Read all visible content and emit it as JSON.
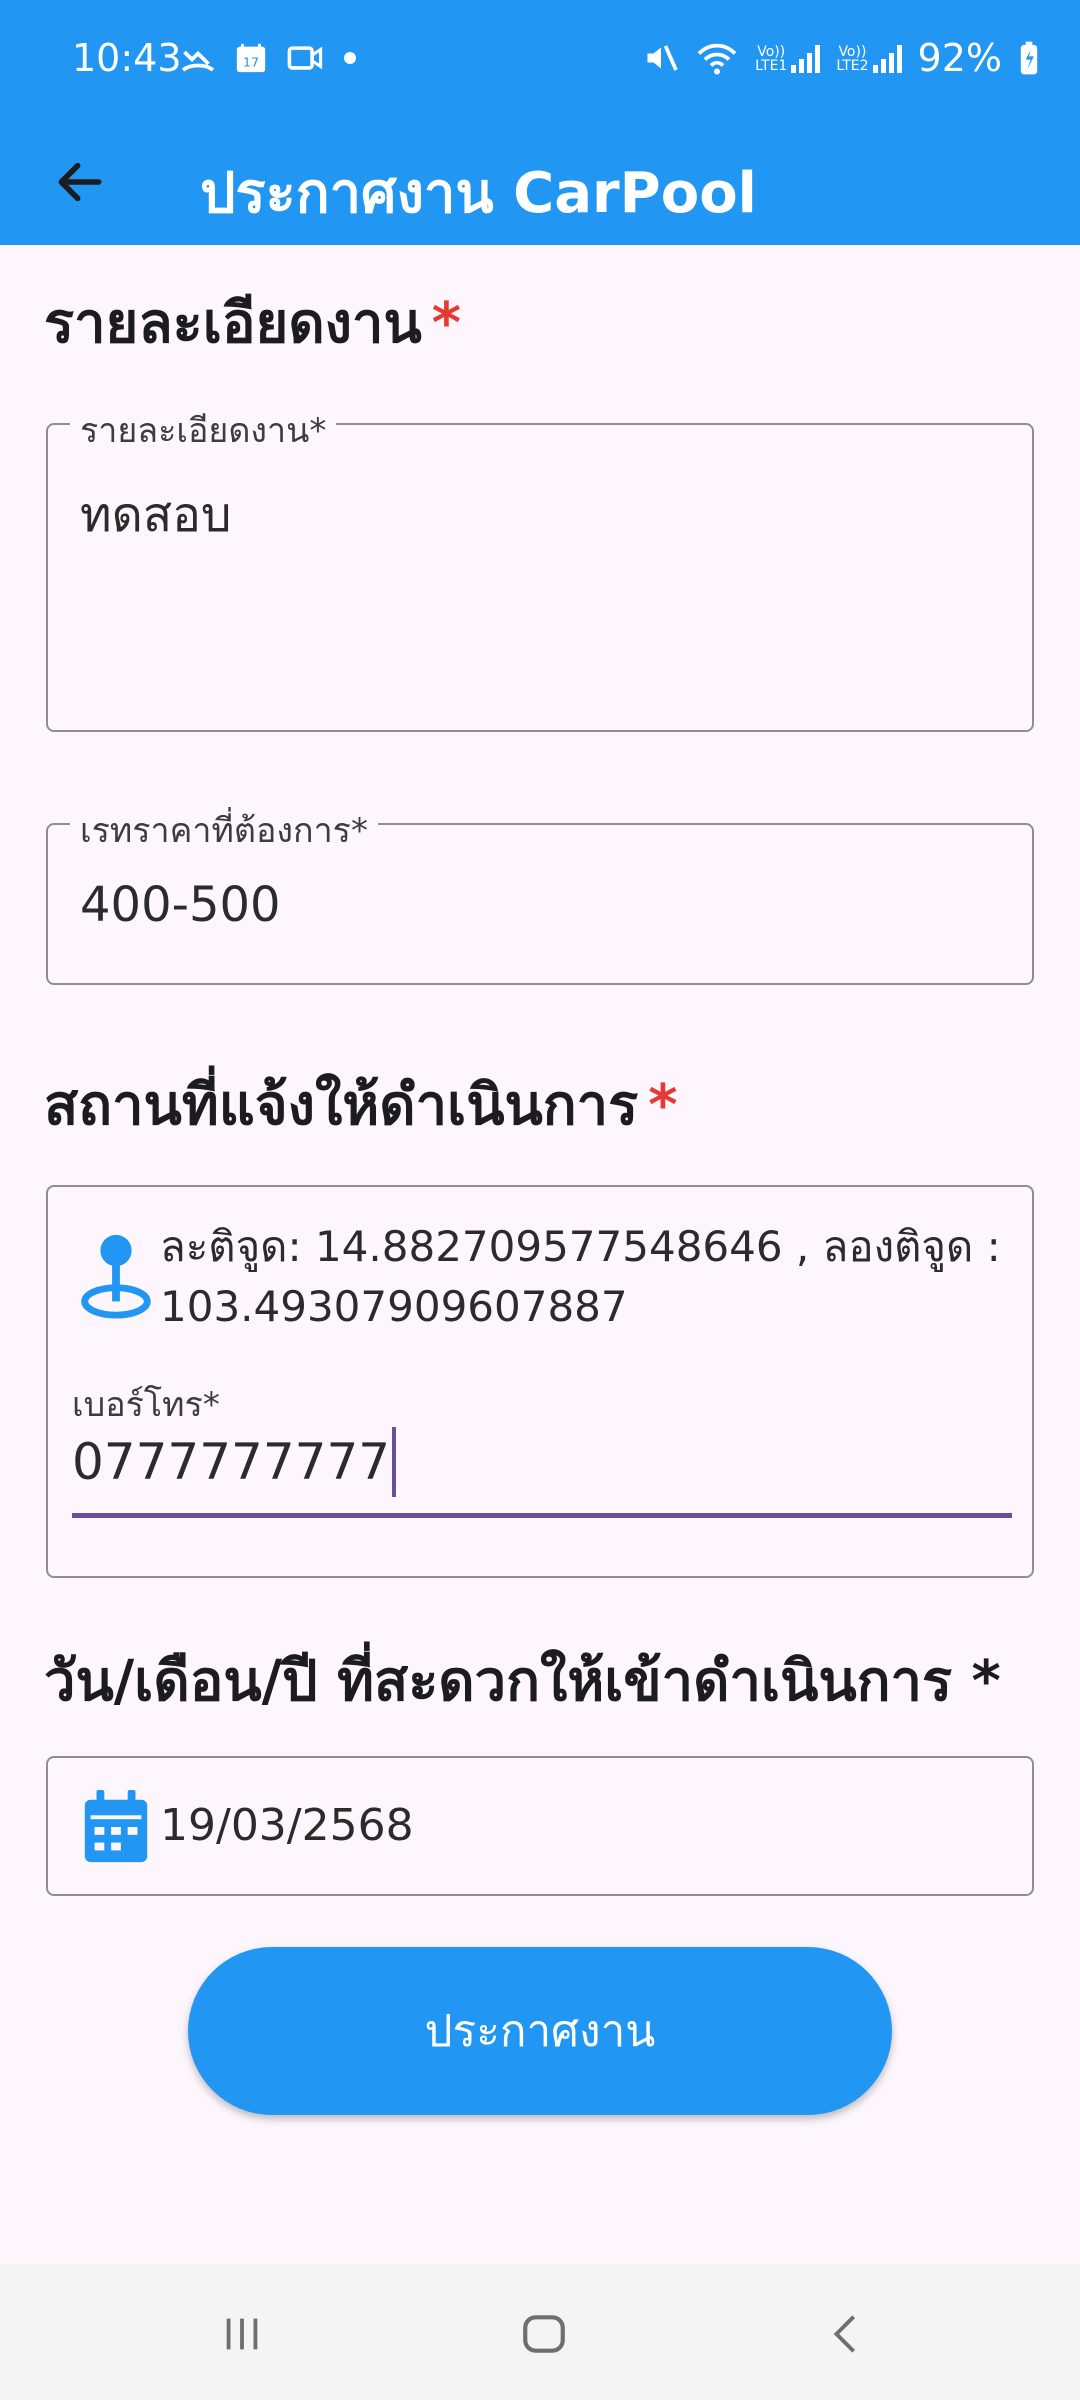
{
  "status_bar": {
    "time": "10:43",
    "battery": "92%",
    "sim1": "LTE1",
    "sim2": "LTE2",
    "volte": "Vo))"
  },
  "app_bar": {
    "title": "ประกาศงาน CarPool",
    "back_icon": "arrow-left-icon"
  },
  "details_section": {
    "title": "รายละเอียดงาน",
    "required_mark": "*",
    "field_label": "รายละเอียดงาน*",
    "field_value": "ทดสอบ"
  },
  "price_field": {
    "label": "เรทราคาที่ต้องการ*",
    "value": "400-500"
  },
  "location_section": {
    "title": "สถานที่แจ้งให้ดำเนินการ",
    "required_mark": "*",
    "location_text": "ละติจูด: 14.882709577548646 , ลองติจูด : 103.49307909607887",
    "location_icon": "map-pin-icon",
    "phone_label": "เบอร์โทร*",
    "phone_value": "0777777777"
  },
  "date_section": {
    "title": "วัน/เดือน/ปี ที่สะดวกให้เข้าดำเนินการ *",
    "date_value": "19/03/2568",
    "calendar_icon": "calendar-icon"
  },
  "submit": {
    "label": "ประกาศงาน"
  },
  "colors": {
    "primary": "#2196f3",
    "required": "#e53935",
    "focus": "#6b4f99",
    "background": "#fdf7fd"
  }
}
